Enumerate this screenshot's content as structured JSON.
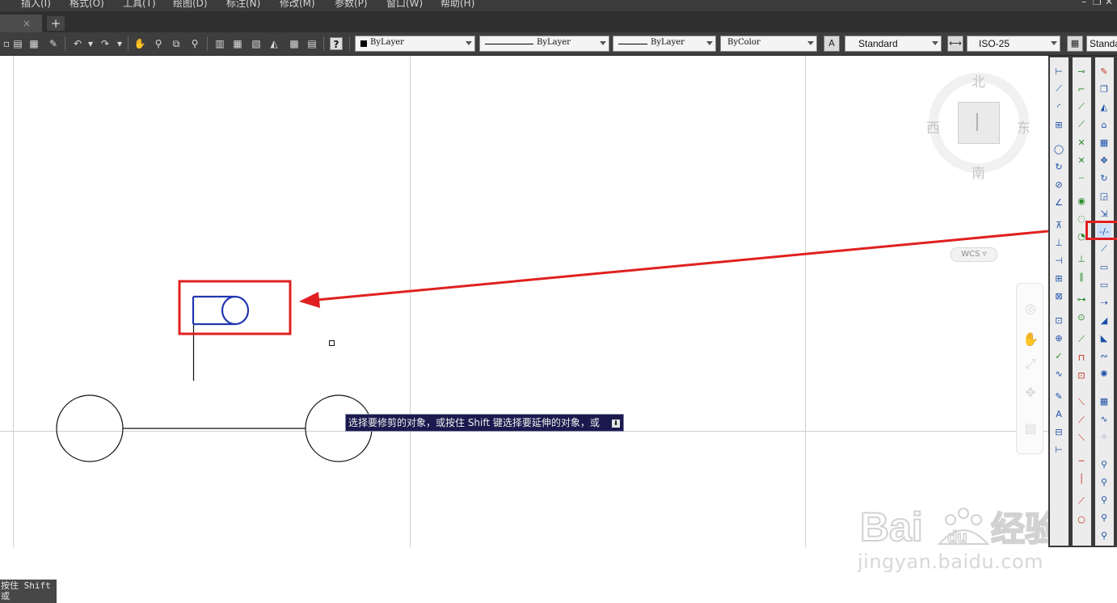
{
  "menu": {
    "items": [
      "插入(I)",
      "格式(O)",
      "工具(T)",
      "绘图(D)",
      "标注(N)",
      "修改(M)",
      "参数(P)",
      "窗口(W)",
      "帮助(H)"
    ]
  },
  "tabs": {
    "close_glyph": "×",
    "add_glyph": "+"
  },
  "toolbar": {
    "color_value": "ByLayer",
    "linetype_value": "ByLayer",
    "lineweight_value": "ByLayer",
    "plotstyle_value": "ByColor",
    "text_style_value": "Standard",
    "dim_style_value": "ISO-25",
    "table_style_value": "Standa",
    "help_glyph": "?"
  },
  "viewcube": {
    "north": "北",
    "south": "南",
    "east": "东",
    "west": "西",
    "wcs_label": "WCS"
  },
  "tooltip": {
    "text": "选择要修剪的对象，或按住 Shift 键选择要延伸的对象，或"
  },
  "command_line": {
    "line1": "按住 Shift",
    "line2": "或"
  },
  "watermark": {
    "url": "jingyan.baidu.com"
  },
  "colors": {
    "selected_entity": "#2136b0",
    "annotation_red": "#e02020",
    "tooltip_bg": "#1a1a4e",
    "panel_bg": "#3a3a3a"
  }
}
